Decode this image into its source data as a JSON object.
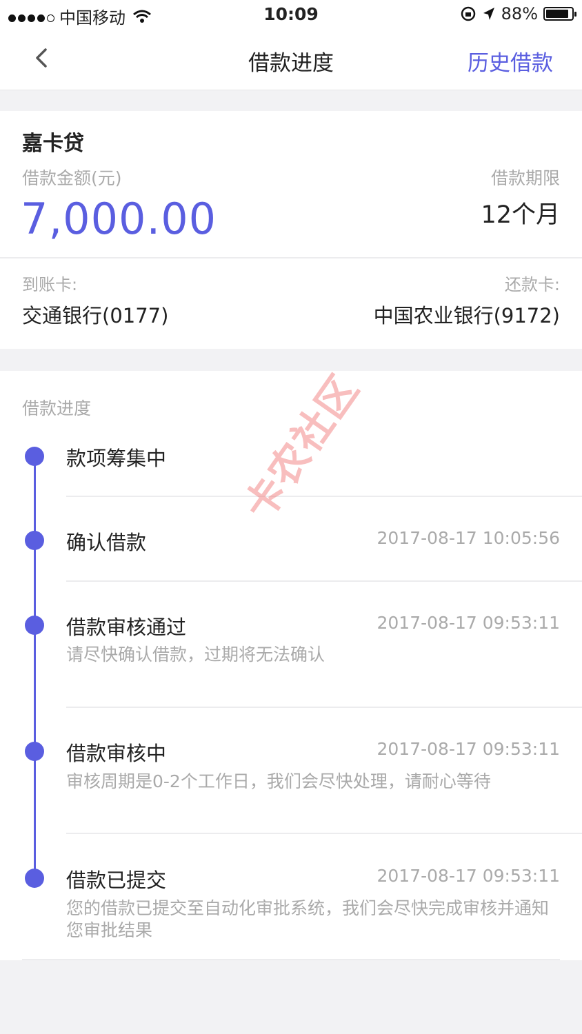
{
  "status_bar": {
    "carrier": "中国移动",
    "time": "10:09",
    "battery": "88%",
    "battery_level": 0.88,
    "icons": [
      "signal-dots-icon",
      "wifi-icon",
      "rotation-lock-icon",
      "location-icon",
      "battery-icon"
    ]
  },
  "nav": {
    "title": "借款进度",
    "action": "历史借款",
    "back_icon": "chevron-left-icon",
    "accent_color": "#5a5ee0"
  },
  "loan": {
    "product": "嘉卡贷",
    "amount_label": "借款金额(元)",
    "amount": "7,000.00",
    "term_label": "借款期限",
    "term": "12个月",
    "receive_card_label": "到账卡:",
    "receive_card": "交通银行(0177)",
    "repay_card_label": "还款卡:",
    "repay_card": "中国农业银行(9172)"
  },
  "progress": {
    "title": "借款进度",
    "steps": [
      {
        "title": "款项筹集中",
        "time": "",
        "desc": ""
      },
      {
        "title": "确认借款",
        "time": "2017-08-17 10:05:56",
        "desc": ""
      },
      {
        "title": "借款审核通过",
        "time": "2017-08-17 09:53:11",
        "desc": "请尽快确认借款，过期将无法确认"
      },
      {
        "title": "借款审核中",
        "time": "2017-08-17 09:53:11",
        "desc": "审核周期是0-2个工作日，我们会尽快处理，请耐心等待"
      },
      {
        "title": "借款已提交",
        "time": "2017-08-17 09:53:11",
        "desc": "您的借款已提交至自动化审批系统，我们会尽快完成审核并通知您审批结果"
      }
    ]
  },
  "watermark": "卡农社区"
}
